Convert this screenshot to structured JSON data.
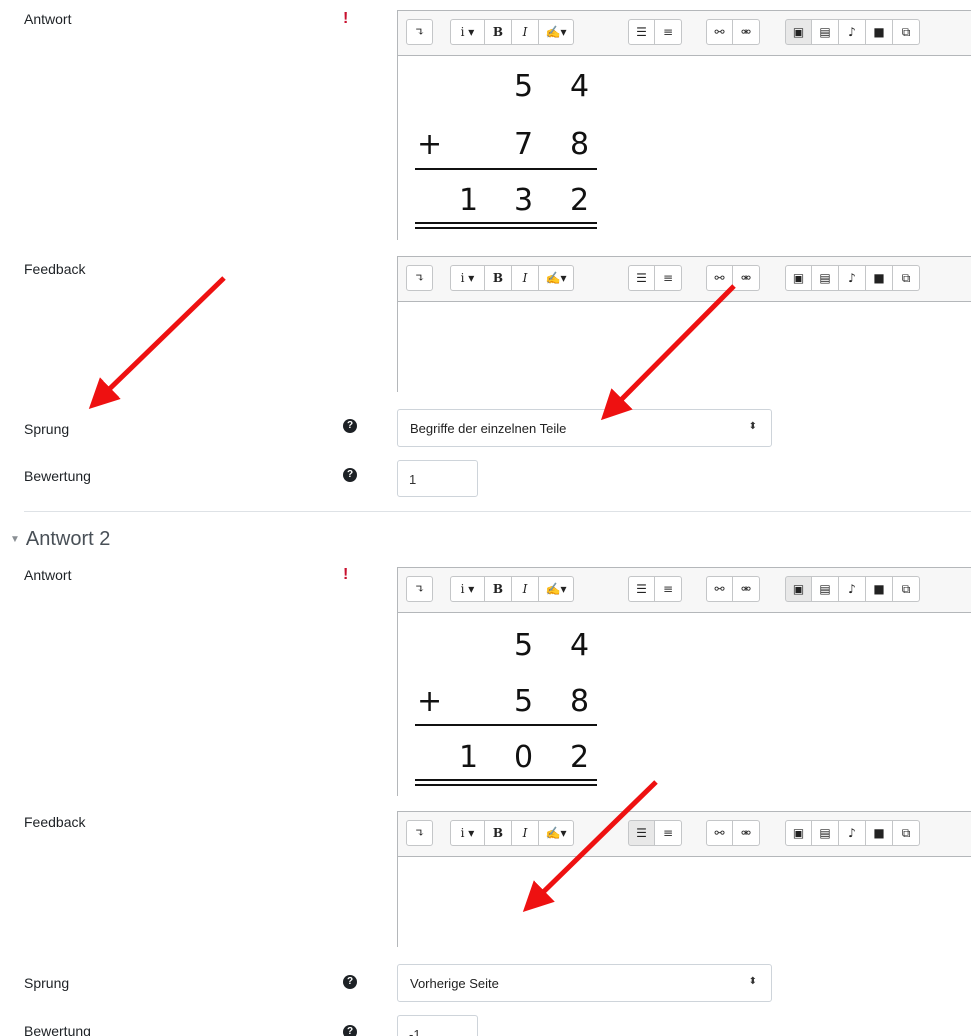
{
  "toolbar": {
    "buttons": [
      "expand-toolbar",
      "info",
      "bold",
      "italic",
      "style",
      "bullet-list",
      "numbered-list",
      "link",
      "unlink",
      "image",
      "media",
      "record-audio",
      "record-video",
      "manage-files"
    ],
    "labels": {
      "info": "i ▾",
      "bold": "B",
      "italic": "I",
      "style": "✍▾"
    }
  },
  "answers": [
    {
      "label_answer": "Antwort",
      "label_feedback": "Feedback",
      "label_jump": "Sprung",
      "label_score": "Bewertung",
      "answer_digits": {
        "row1": [
          "5",
          "4"
        ],
        "op": "+",
        "row2": [
          "7",
          "8"
        ],
        "result": [
          "1",
          "3",
          "2"
        ]
      },
      "jump_value": "Begriffe der einzelnen Teile",
      "score_value": "1"
    },
    {
      "section_title": "Antwort 2",
      "label_answer": "Antwort",
      "label_feedback": "Feedback",
      "label_jump": "Sprung",
      "label_score": "Bewertung",
      "answer_digits": {
        "row1": [
          "5",
          "4"
        ],
        "op": "+",
        "row2": [
          "5",
          "8"
        ],
        "result": [
          "1",
          "0",
          "2"
        ]
      },
      "jump_value": "Vorherige Seite",
      "score_value": "-1"
    }
  ],
  "colors": {
    "required": "#c8102e",
    "annotation_arrow": "#ee1111"
  }
}
